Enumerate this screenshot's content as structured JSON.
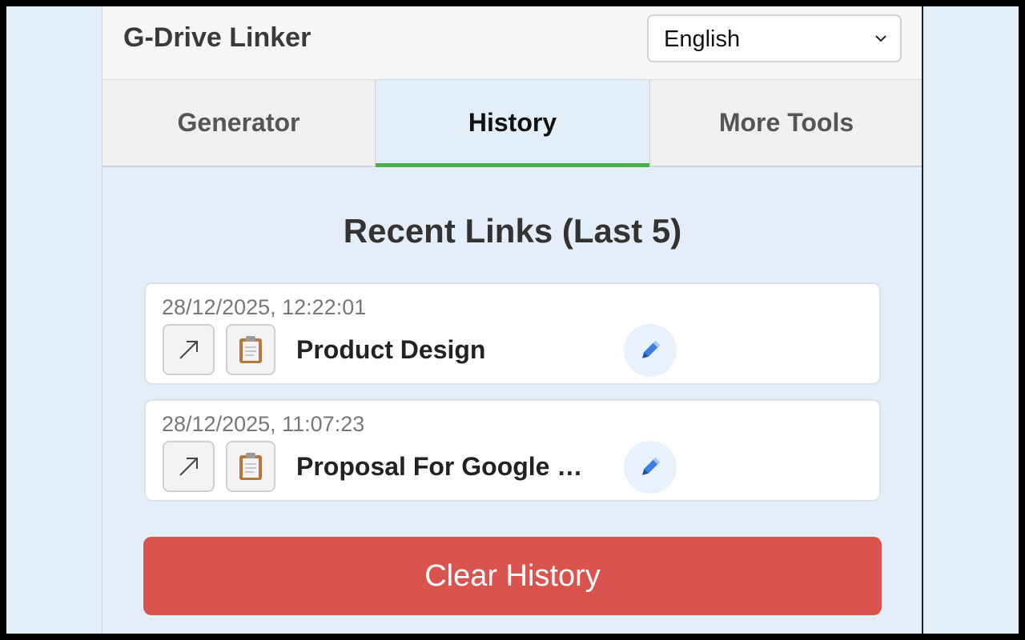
{
  "header": {
    "title": "G-Drive Linker",
    "language": {
      "selected": "English",
      "icon": "chevron-down-icon"
    }
  },
  "tabs": [
    {
      "label": "Generator",
      "active": false
    },
    {
      "label": "History",
      "active": true
    },
    {
      "label": "More Tools",
      "active": false
    }
  ],
  "history": {
    "title": "Recent Links (Last 5)",
    "items": [
      {
        "timestamp": "28/12/2025, 12:22:01",
        "name": "Product Design"
      },
      {
        "timestamp": "28/12/2025, 11:07:23",
        "name": "Proposal For Google …"
      }
    ],
    "clear_label": "Clear History"
  },
  "colors": {
    "active_tab_indicator": "#4caf50",
    "clear_button": "#d9534f",
    "background": "#e3eef9"
  },
  "icons": {
    "open": "external-link-arrow-icon",
    "copy": "clipboard-icon",
    "edit": "pencil-icon"
  }
}
